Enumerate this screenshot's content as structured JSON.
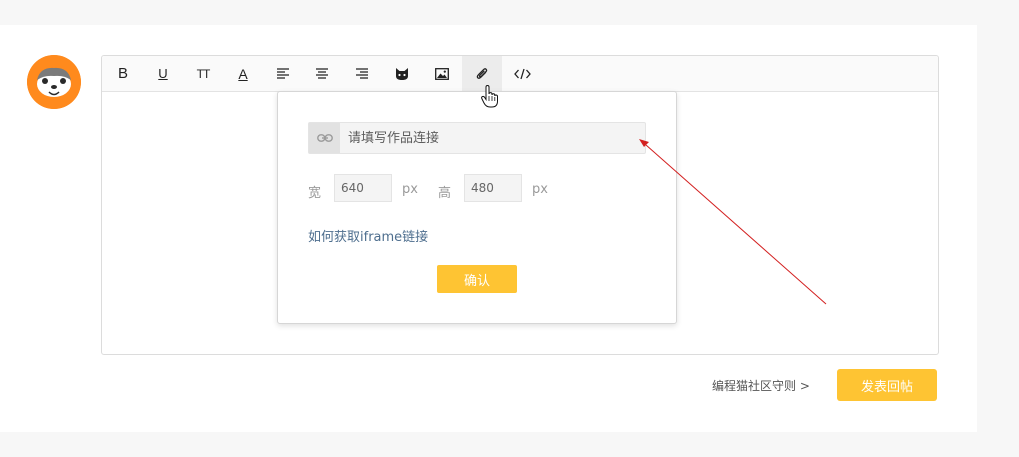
{
  "toolbar": {
    "bold": "B",
    "underline": "U",
    "text_size": "TT",
    "font_color": "A"
  },
  "embed_popup": {
    "url_placeholder": "请填写作品连接",
    "width_label": "宽",
    "width_value": "640",
    "width_unit": "px",
    "height_label": "高",
    "height_value": "480",
    "height_unit": "px",
    "help_link": "如何获取iframe链接",
    "confirm_label": "确认"
  },
  "footer": {
    "rules_link": "编程猫社区守则 >",
    "submit_label": "发表回帖"
  },
  "colors": {
    "accent": "#fec433",
    "avatar_bg": "#ff8a1d",
    "link": "#4e6e8e",
    "annotation_arrow": "#d32020"
  }
}
